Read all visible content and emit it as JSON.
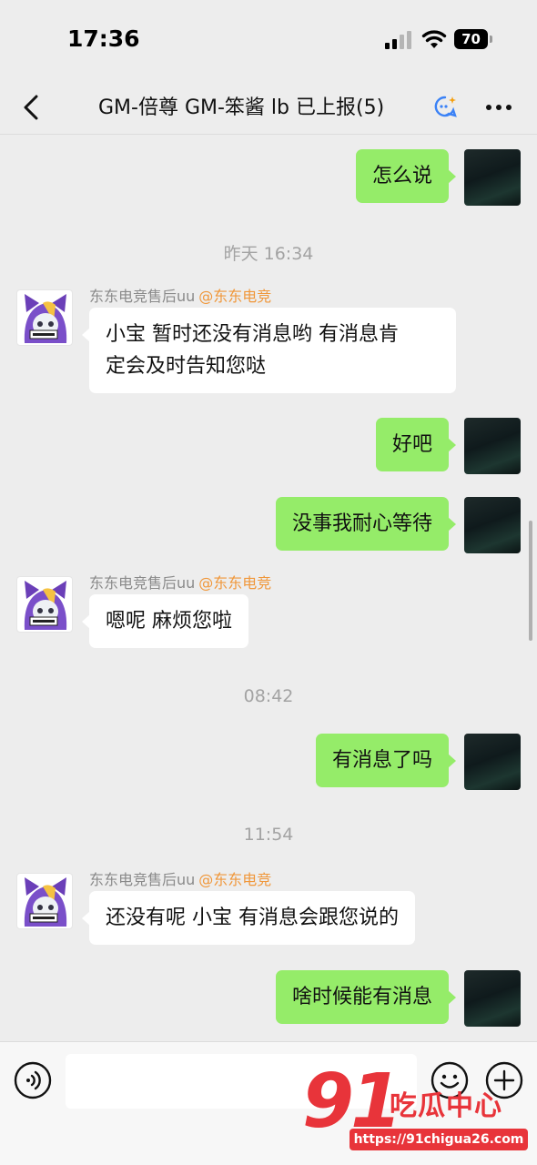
{
  "status": {
    "time": "17:36",
    "battery": "70"
  },
  "nav": {
    "title": "GM-倍尊 GM-笨酱 lb 已上报(5)"
  },
  "messages": {
    "m1": {
      "text": "怎么说"
    },
    "ts1": "昨天 16:34",
    "m2": {
      "sender": "东东电竞售后uu",
      "tag": "@东东电竞",
      "text_line1": "小宝 暂时还没有消息哟 有消息肯",
      "text_line2": "定会及时告知您哒"
    },
    "m3": {
      "text": "好吧"
    },
    "m4": {
      "text": "没事我耐心等待"
    },
    "m5": {
      "sender": "东东电竞售后uu",
      "tag": "@东东电竞",
      "text": "嗯呢 麻烦您啦"
    },
    "ts2": "08:42",
    "m6": {
      "text": "有消息了吗"
    },
    "ts3": "11:54",
    "m7": {
      "sender": "东东电竞售后uu",
      "tag": "@东东电竞",
      "text": "还没有呢 小宝 有消息会跟您说的"
    },
    "m8": {
      "text": "啥时候能有消息"
    }
  },
  "input": {
    "value": ""
  },
  "watermark": {
    "number": "91",
    "name": "吃瓜中心",
    "url": "https://91chigua26.com"
  },
  "icons": {
    "back": "chevron-left-icon",
    "title_badge": "group-ai-icon",
    "more": "more-icon",
    "voice": "voice-icon",
    "emoji": "emoji-icon",
    "plus": "plus-icon"
  },
  "colors": {
    "my_bubble": "#95ec69",
    "their_bubble": "#ffffff",
    "tag": "#f0973a",
    "watermark": "#e8343a"
  }
}
